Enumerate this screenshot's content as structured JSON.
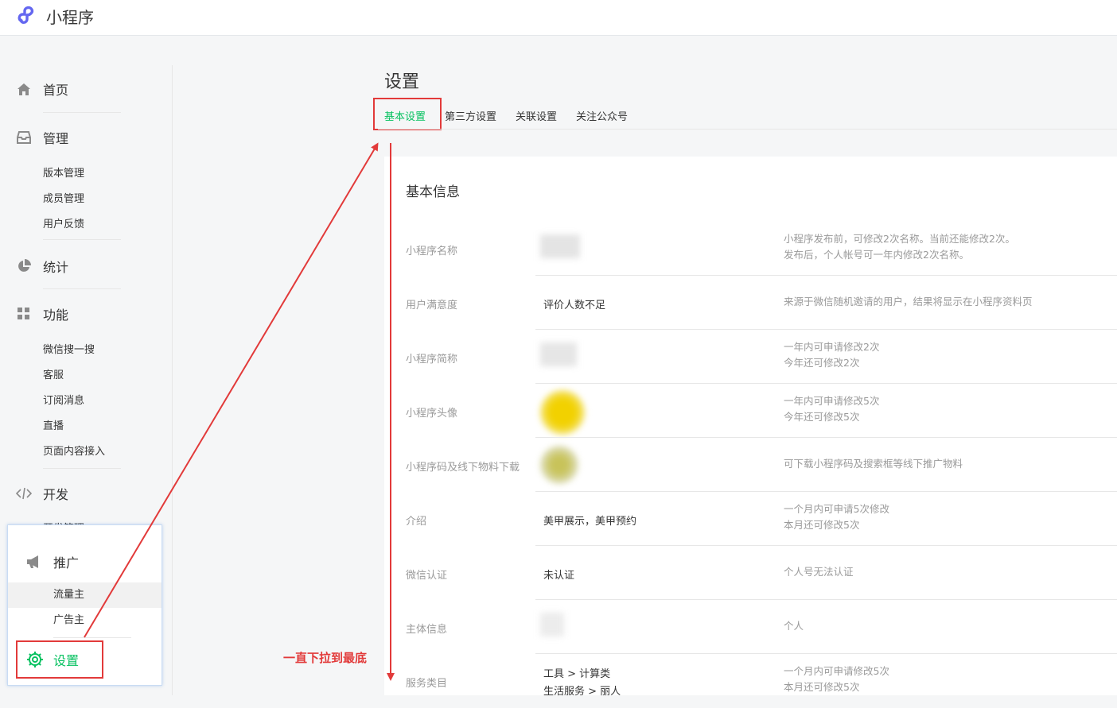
{
  "header": {
    "app_name": "小程序",
    "logo_icon": "mini-program-logo-icon"
  },
  "sidebar": {
    "sections": [
      {
        "label": "首页",
        "icon": "home-icon"
      },
      {
        "label": "管理",
        "icon": "inbox-icon",
        "items": [
          "版本管理",
          "成员管理",
          "用户反馈"
        ]
      },
      {
        "label": "统计",
        "icon": "pie-chart-icon"
      },
      {
        "label": "功能",
        "icon": "grid-icon",
        "items": [
          "微信搜一搜",
          "客服",
          "订阅消息",
          "直播",
          "页面内容接入"
        ]
      },
      {
        "label": "开发",
        "icon": "code-icon",
        "items": [
          "开发管理"
        ]
      }
    ],
    "popup": {
      "label": "推广",
      "icon": "megaphone-icon",
      "items": [
        "流量主",
        "广告主"
      ],
      "settings_label": "设置",
      "settings_icon": "gear-icon"
    }
  },
  "main": {
    "title": "设置",
    "tabs": [
      "基本设置",
      "第三方设置",
      "关联设置",
      "关注公众号"
    ],
    "active_tab": "基本设置",
    "section_title": "基本信息",
    "rows": [
      {
        "label": "小程序名称",
        "value": "",
        "desc": [
          "小程序发布前，可修改2次名称。当前还能修改2次。",
          "发布后，个人帐号可一年内修改2次名称。"
        ]
      },
      {
        "label": "用户满意度",
        "value": "评价人数不足",
        "desc": [
          "来源于微信随机邀请的用户，结果将显示在小程序资料页"
        ]
      },
      {
        "label": "小程序简称",
        "value": "",
        "desc": [
          "一年内可申请修改2次",
          "今年还可修改2次"
        ]
      },
      {
        "label": "小程序头像",
        "value": "",
        "desc": [
          "一年内可申请修改5次",
          "今年还可修改5次"
        ]
      },
      {
        "label": "小程序码及线下物料下载",
        "value": "",
        "desc": [
          "可下载小程序码及搜索框等线下推广物料"
        ]
      },
      {
        "label": "介绍",
        "value": "美甲展示，美甲预约",
        "desc": [
          "一个月内可申请5次修改",
          "本月还可修改5次"
        ]
      },
      {
        "label": "微信认证",
        "value": "未认证",
        "desc": [
          "个人号无法认证"
        ]
      },
      {
        "label": "主体信息",
        "value": "",
        "desc": [
          "个人"
        ]
      },
      {
        "label": "服务类目",
        "value_lines": [
          "工具 > 计算类",
          "生活服务 > 丽人"
        ],
        "desc": [
          "一个月内可申请修改5次",
          "本月还可修改5次"
        ]
      }
    ]
  },
  "annotation": {
    "text": "一直下拉到最底",
    "color": "#e23a3a"
  },
  "colors": {
    "accent": "#07c160",
    "annotation": "#e23a3a"
  }
}
